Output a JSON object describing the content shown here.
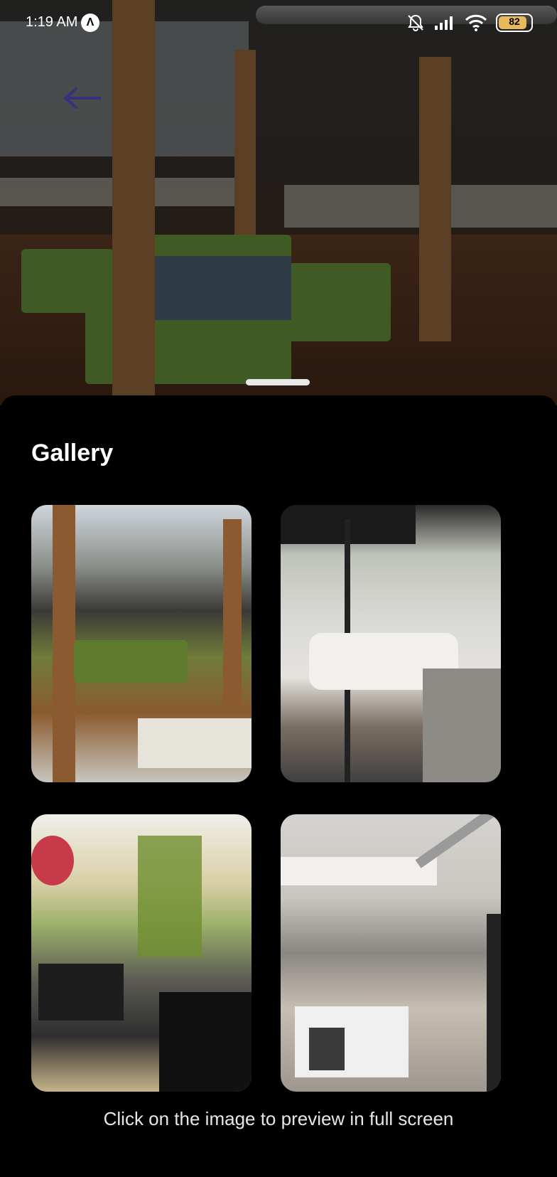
{
  "status_bar": {
    "time": "1:19 AM",
    "nav_glyph": "Λ",
    "battery": "82",
    "icons": [
      "bell-off-icon",
      "signal-icon",
      "wifi-icon",
      "battery-icon"
    ]
  },
  "header": {
    "back_icon": "arrow-left-icon",
    "accent_color": "#3a2f7a"
  },
  "gallery": {
    "title": "Gallery",
    "images": [
      {
        "name": "office-lounge-photo"
      },
      {
        "name": "studio-interview-photo"
      },
      {
        "name": "decorated-office-photo"
      },
      {
        "name": "industrial-office-photo"
      }
    ],
    "hint": "Click on the image to preview in full screen"
  }
}
